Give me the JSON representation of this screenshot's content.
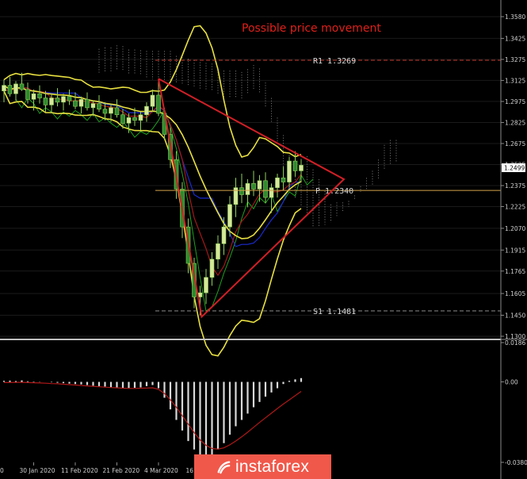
{
  "title": "Possible price movement",
  "chart_data": {
    "type": "candlestick",
    "price_axis": {
      "ticks": [
        "1.3580",
        "1.3425",
        "1.3275",
        "1.3125",
        "1.2975",
        "1.2825",
        "1.2675",
        "1.2525",
        "1.2375",
        "1.2225",
        "1.2070",
        "1.1915",
        "1.1765",
        "1.1605",
        "1.1450",
        "1.1300"
      ],
      "range": [
        1.13,
        1.358
      ],
      "current_price": "1.2499"
    },
    "levels": [
      {
        "label": "R1",
        "value": "1.3269",
        "color": "#c0392b"
      },
      {
        "label": "P",
        "value": "1.2340",
        "color": "#d2a24a"
      },
      {
        "label": "S1",
        "value": "1.1481",
        "color": "#8c8c8c"
      }
    ],
    "date_labels": [
      "30 Jan 2020",
      "11 Feb 2020",
      "21 Feb 2020",
      "4 Mar 2020",
      "16 Ma"
    ],
    "left_date_fragment": "0",
    "oscillator": {
      "ticks": [
        "0.0186",
        "0.00",
        "-0.03808"
      ],
      "range": [
        -0.03808,
        0.0186
      ]
    },
    "candles": [
      [
        1.305,
        1.313,
        1.297,
        1.309
      ],
      [
        1.309,
        1.315,
        1.301,
        1.303
      ],
      [
        1.303,
        1.312,
        1.298,
        1.31
      ],
      [
        1.31,
        1.318,
        1.305,
        1.306
      ],
      [
        1.306,
        1.311,
        1.296,
        1.299
      ],
      [
        1.299,
        1.306,
        1.291,
        1.303
      ],
      [
        1.303,
        1.309,
        1.296,
        1.3
      ],
      [
        1.3,
        1.305,
        1.29,
        1.295
      ],
      [
        1.295,
        1.303,
        1.289,
        1.3
      ],
      [
        1.3,
        1.307,
        1.294,
        1.297
      ],
      [
        1.297,
        1.303,
        1.291,
        1.301
      ],
      [
        1.301,
        1.306,
        1.295,
        1.298
      ],
      [
        1.298,
        1.304,
        1.292,
        1.294
      ],
      [
        1.294,
        1.301,
        1.289,
        1.299
      ],
      [
        1.299,
        1.304,
        1.291,
        1.293
      ],
      [
        1.293,
        1.298,
        1.287,
        1.296
      ],
      [
        1.296,
        1.302,
        1.29,
        1.292
      ],
      [
        1.292,
        1.297,
        1.284,
        1.289
      ],
      [
        1.289,
        1.296,
        1.283,
        1.293
      ],
      [
        1.293,
        1.299,
        1.286,
        1.288
      ],
      [
        1.288,
        1.292,
        1.278,
        1.282
      ],
      [
        1.282,
        1.289,
        1.275,
        1.286
      ],
      [
        1.286,
        1.293,
        1.28,
        1.284
      ],
      [
        1.284,
        1.29,
        1.277,
        1.288
      ],
      [
        1.288,
        1.297,
        1.283,
        1.294
      ],
      [
        1.294,
        1.306,
        1.29,
        1.302
      ],
      [
        1.302,
        1.312,
        1.287,
        1.289
      ],
      [
        1.289,
        1.293,
        1.27,
        1.274
      ],
      [
        1.274,
        1.279,
        1.25,
        1.256
      ],
      [
        1.256,
        1.262,
        1.228,
        1.235
      ],
      [
        1.235,
        1.24,
        1.2,
        1.208
      ],
      [
        1.208,
        1.214,
        1.175,
        1.182
      ],
      [
        1.182,
        1.186,
        1.15,
        1.158
      ],
      [
        1.158,
        1.166,
        1.145,
        1.161
      ],
      [
        1.161,
        1.178,
        1.153,
        1.172
      ],
      [
        1.172,
        1.19,
        1.166,
        1.185
      ],
      [
        1.185,
        1.202,
        1.178,
        1.196
      ],
      [
        1.196,
        1.215,
        1.188,
        1.208
      ],
      [
        1.208,
        1.23,
        1.201,
        1.224
      ],
      [
        1.224,
        1.243,
        1.215,
        1.236
      ],
      [
        1.236,
        1.246,
        1.225,
        1.231
      ],
      [
        1.231,
        1.242,
        1.222,
        1.239
      ],
      [
        1.239,
        1.248,
        1.23,
        1.235
      ],
      [
        1.235,
        1.245,
        1.226,
        1.241
      ],
      [
        1.241,
        1.247,
        1.225,
        1.229
      ],
      [
        1.229,
        1.239,
        1.218,
        1.236
      ],
      [
        1.236,
        1.246,
        1.229,
        1.243
      ],
      [
        1.243,
        1.251,
        1.234,
        1.24
      ],
      [
        1.24,
        1.258,
        1.236,
        1.255
      ],
      [
        1.255,
        1.262,
        1.244,
        1.248
      ],
      [
        1.248,
        1.256,
        1.24,
        1.252
      ]
    ],
    "histogram": [
      0.0005,
      0.0006,
      0.0004,
      0.0007,
      0.0003,
      0.0002,
      0.0001,
      0.0,
      -0.0002,
      -0.0004,
      -0.0006,
      -0.0008,
      -0.001,
      -0.0012,
      -0.0015,
      -0.0018,
      -0.002,
      -0.0022,
      -0.0025,
      -0.0027,
      -0.0028,
      -0.0029,
      -0.0028,
      -0.0026,
      -0.002,
      -0.0015,
      -0.003,
      -0.0075,
      -0.013,
      -0.018,
      -0.023,
      -0.028,
      -0.032,
      -0.035,
      -0.036,
      -0.0345,
      -0.032,
      -0.029,
      -0.025,
      -0.021,
      -0.018,
      -0.015,
      -0.012,
      -0.0095,
      -0.007,
      -0.005,
      -0.003,
      -0.001,
      0.0005,
      0.0012,
      0.0018
    ],
    "signal_line": [
      -0.0003,
      -0.0003,
      -0.0002,
      -0.0002,
      -0.0003,
      -0.0004,
      -0.0005,
      -0.0006,
      -0.0008,
      -0.0009,
      -0.0011,
      -0.0013,
      -0.0015,
      -0.0017,
      -0.0019,
      -0.0021,
      -0.0023,
      -0.0025,
      -0.0027,
      -0.0028,
      -0.003,
      -0.0031,
      -0.0031,
      -0.003,
      -0.0029,
      -0.0028,
      -0.0035,
      -0.0055,
      -0.0085,
      -0.012,
      -0.016,
      -0.02,
      -0.024,
      -0.0275,
      -0.03,
      -0.0315,
      -0.0318,
      -0.0312,
      -0.0298,
      -0.028,
      -0.026,
      -0.0238,
      -0.0215,
      -0.0192,
      -0.017,
      -0.0148,
      -0.0126,
      -0.0105,
      -0.0085,
      -0.0065,
      -0.0045
    ]
  },
  "logo": {
    "text": "instaforex"
  }
}
